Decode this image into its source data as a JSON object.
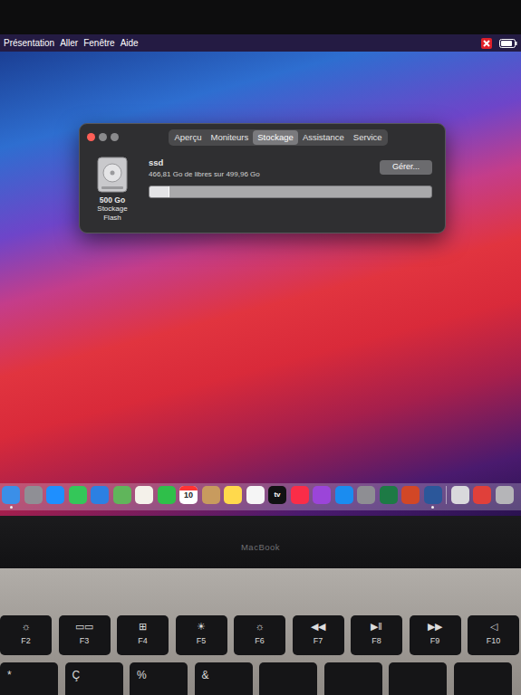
{
  "menu_bar": {
    "items": [
      "Présentation",
      "Aller",
      "Fenêtre",
      "Aide"
    ]
  },
  "window": {
    "tabs": [
      {
        "label": "Aperçu",
        "selected": false
      },
      {
        "label": "Moniteurs",
        "selected": false
      },
      {
        "label": "Stockage",
        "selected": true
      },
      {
        "label": "Assistance",
        "selected": false
      },
      {
        "label": "Service",
        "selected": false
      }
    ],
    "disk": {
      "capacity": "500 Go",
      "type": "Stockage Flash",
      "name": "ssd",
      "summary": "466,81 Go de libres sur 499,96 Go",
      "level": 0.07
    },
    "button": "Gérer..."
  },
  "dock": {
    "items": [
      {
        "kind": "app",
        "running": true
      },
      {
        "kind": "app",
        "running": false
      },
      {
        "kind": "app",
        "running": false
      },
      {
        "kind": "app",
        "running": false
      },
      {
        "kind": "app",
        "running": false
      },
      {
        "kind": "app",
        "running": false
      },
      {
        "kind": "app",
        "running": false
      },
      {
        "kind": "app",
        "running": false
      },
      {
        "kind": "calendar",
        "text": "10",
        "running": false
      },
      {
        "kind": "app",
        "running": false
      },
      {
        "kind": "app",
        "running": false
      },
      {
        "kind": "app",
        "running": false
      },
      {
        "kind": "tv",
        "text": "tv",
        "running": false
      },
      {
        "kind": "app",
        "running": false
      },
      {
        "kind": "app",
        "running": false
      },
      {
        "kind": "app",
        "running": false
      },
      {
        "kind": "app",
        "running": false
      },
      {
        "kind": "app",
        "running": false
      },
      {
        "kind": "app",
        "running": false
      },
      {
        "kind": "app",
        "running": true
      },
      {
        "kind": "app",
        "running": false
      },
      {
        "kind": "app",
        "running": false
      },
      {
        "kind": "app",
        "running": false
      }
    ]
  },
  "bezel": {
    "label": "MacBook"
  },
  "keyboard": {
    "function_keys": [
      {
        "icon": "☼",
        "label": "F2"
      },
      {
        "icon": "▭▭",
        "label": "F3"
      },
      {
        "icon": "⊞",
        "label": "F4"
      },
      {
        "icon": "☀",
        "label": "F5"
      },
      {
        "icon": "☼",
        "label": "F6"
      },
      {
        "icon": "◀◀",
        "label": "F7"
      },
      {
        "icon": "▶‖",
        "label": "F8"
      },
      {
        "icon": "▶▶",
        "label": "F9"
      },
      {
        "icon": "◁",
        "label": "F10"
      }
    ],
    "bottom_keys": [
      "*",
      "Ç",
      "%",
      "&"
    ]
  }
}
